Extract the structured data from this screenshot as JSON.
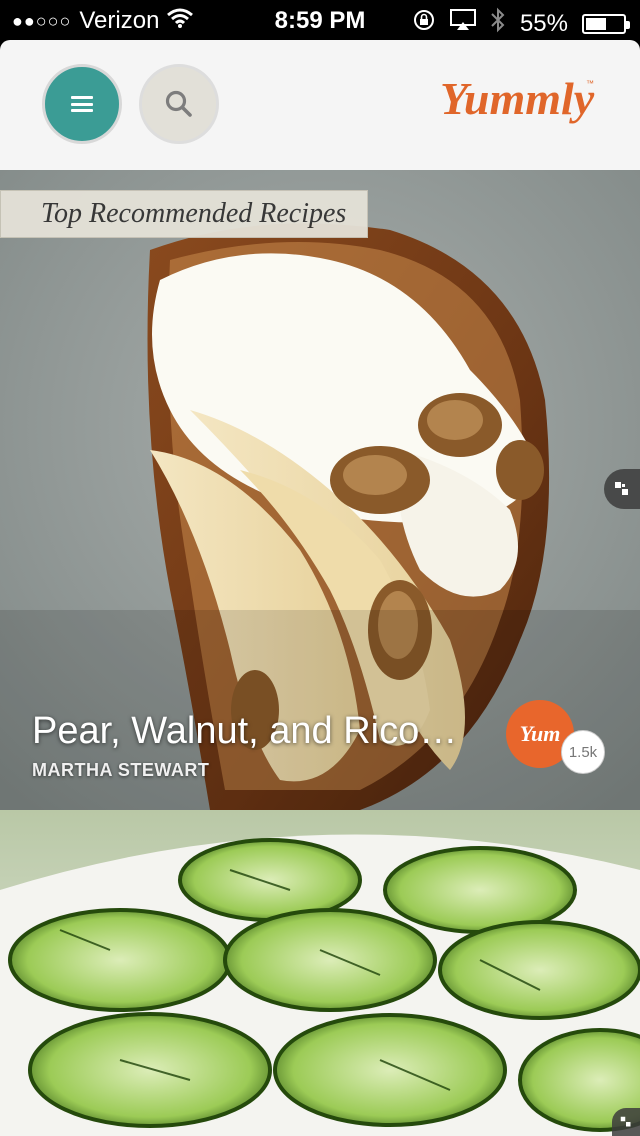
{
  "status_bar": {
    "signal_dots": "●●○○○",
    "carrier": "Verizon",
    "time": "8:59 PM",
    "battery_percent": "55%",
    "battery_level": 0.55
  },
  "header": {
    "logo_text": "Yummly",
    "logo_color": "#e0662a"
  },
  "feed": {
    "section_label": "Top Recommended Recipes",
    "cards": [
      {
        "title": "Pear, Walnut, and Rico…",
        "source": "MARTHA STEWART",
        "yum_label": "Yum",
        "yum_count": "1.5k"
      },
      {
        "title": "",
        "source": ""
      }
    ]
  },
  "colors": {
    "accent_teal": "#3b9c95",
    "yum_orange": "#e8662c"
  }
}
